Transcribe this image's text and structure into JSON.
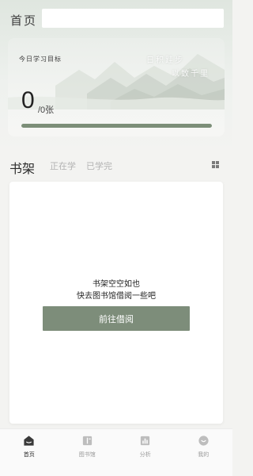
{
  "header": {
    "title": "首页",
    "search_placeholder": ""
  },
  "goal_card": {
    "label": "今日学习目标",
    "motto_line1": "日积跬步",
    "motto_line2": "以致千里",
    "count": "0",
    "total": "/0张",
    "progress": 1.0
  },
  "shelf": {
    "title": "书架",
    "tabs": [
      {
        "label": "正在学"
      },
      {
        "label": "已学完"
      }
    ],
    "empty_line1": "书架空空如也",
    "empty_line2": "快去图书馆借阅一些吧",
    "borrow_button": "前往借阅"
  },
  "bottom_nav": {
    "items": [
      {
        "label": "首页",
        "icon": "home-icon",
        "active": true
      },
      {
        "label": "图书馆",
        "icon": "library-icon",
        "active": false
      },
      {
        "label": "分析",
        "icon": "analysis-icon",
        "active": false
      },
      {
        "label": "我的",
        "icon": "profile-icon",
        "active": false
      }
    ]
  },
  "colors": {
    "accent": "#7d8d7a",
    "progress_fill": "#7c8e78",
    "nav_active": "#2a2a2a",
    "nav_inactive": "#9a9a9a"
  }
}
